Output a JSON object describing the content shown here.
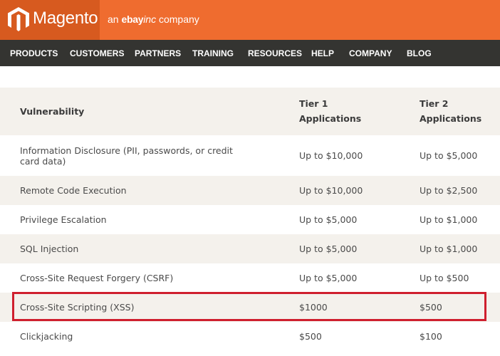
{
  "header": {
    "logo_text": "Magento",
    "tagline_prefix": "an",
    "tagline_brand": "ebay",
    "tagline_inc": "inc",
    "tagline_suffix": "company",
    "brand_color": "#ef6c2f"
  },
  "nav": {
    "items": [
      "PRODUCTS",
      "CUSTOMERS",
      "PARTNERS",
      "TRAINING",
      "RESOURCES",
      "HELP",
      "COMPANY",
      "BLOG"
    ]
  },
  "table": {
    "headers": {
      "col1": "Vulnerability",
      "tier1_line1": "Tier 1",
      "tier1_line2": "Applications",
      "tier2_line1": "Tier 2",
      "tier2_line2": "Applications"
    },
    "rows": [
      {
        "vulnerability": "Information Disclosure (PII, passwords, or credit card data)",
        "tier1": "Up to $10,000",
        "tier2": "Up to $5,000"
      },
      {
        "vulnerability": "Remote Code Execution",
        "tier1": "Up to $10,000",
        "tier2": "Up to $2,500"
      },
      {
        "vulnerability": "Privilege Escalation",
        "tier1": "Up to $5,000",
        "tier2": "Up to $1,000"
      },
      {
        "vulnerability": "SQL Injection",
        "tier1": "Up to $5,000",
        "tier2": "Up to $1,000"
      },
      {
        "vulnerability": "Cross-Site Request Forgery (CSRF)",
        "tier1": "Up to $5,000",
        "tier2": "Up to $500"
      },
      {
        "vulnerability": "Cross-Site Scripting (XSS)",
        "tier1": "$1000",
        "tier2": "$500"
      },
      {
        "vulnerability": "Clickjacking",
        "tier1": "$500",
        "tier2": "$100"
      }
    ],
    "highlight_color": "#cf1f2e"
  }
}
